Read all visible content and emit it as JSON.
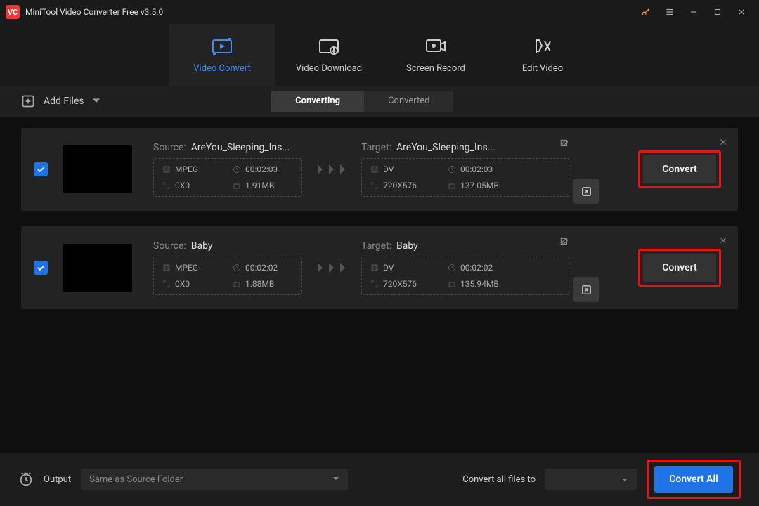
{
  "titlebar": {
    "title": "MiniTool Video Converter Free v3.5.0"
  },
  "main_tabs": [
    {
      "label": "Video Convert",
      "active": true
    },
    {
      "label": "Video Download",
      "active": false
    },
    {
      "label": "Screen Record",
      "active": false
    },
    {
      "label": "Edit Video",
      "active": false
    }
  ],
  "toolbar": {
    "add_files_label": "Add Files",
    "sub_tabs": [
      {
        "label": "Converting",
        "active": true
      },
      {
        "label": "Converted",
        "active": false
      }
    ]
  },
  "labels": {
    "source": "Source:",
    "target": "Target:",
    "convert": "Convert"
  },
  "items": [
    {
      "checked": true,
      "source": {
        "name": "AreYou_Sleeping_Ins...",
        "format": "MPEG",
        "duration": "00:02:03",
        "dimensions": "0X0",
        "size": "1.91MB"
      },
      "target": {
        "name": "AreYou_Sleeping_Ins...",
        "format": "DV",
        "duration": "00:02:03",
        "dimensions": "720X576",
        "size": "137.05MB"
      }
    },
    {
      "checked": true,
      "source": {
        "name": "Baby",
        "format": "MPEG",
        "duration": "00:02:02",
        "dimensions": "0X0",
        "size": "1.88MB"
      },
      "target": {
        "name": "Baby",
        "format": "DV",
        "duration": "00:02:02",
        "dimensions": "720X576",
        "size": "135.94MB"
      }
    }
  ],
  "footer": {
    "output_label": "Output",
    "output_value": "Same as Source Folder",
    "convert_all_files_to": "Convert all files to",
    "convert_all": "Convert All"
  }
}
